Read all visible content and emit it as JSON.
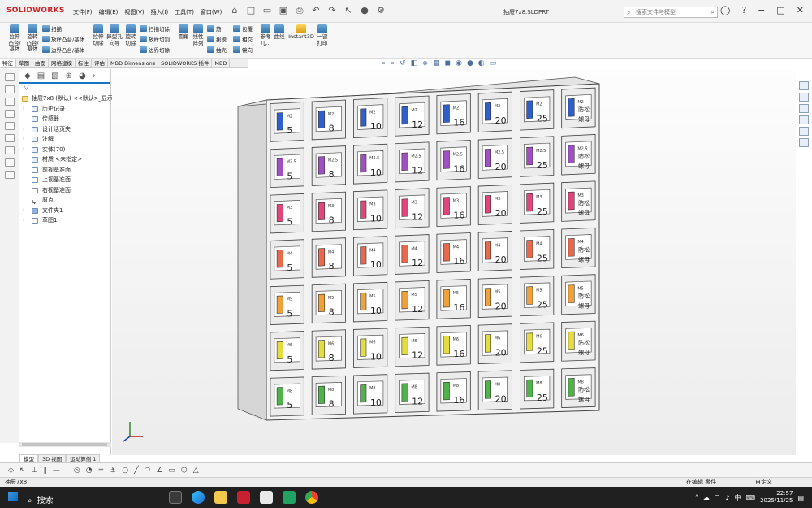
{
  "app": {
    "brand": "SOLIDWORKS",
    "menus": [
      "文件(F)",
      "编辑(E)",
      "视图(V)",
      "插入(I)",
      "工具(T)",
      "窗口(W)"
    ],
    "doc_title": "抽屉7x8.SLDPRT",
    "search_placeholder": "搜索文件与模型"
  },
  "ribbon": {
    "big": [
      {
        "id": "extrude-boss",
        "label": "拉伸\n凸台/\n基体"
      },
      {
        "id": "revolve-boss",
        "label": "旋转\n凸台/\n基体"
      },
      {
        "id": "extrude-cut",
        "label": "拉伸\n切除"
      },
      {
        "id": "hole-wizard",
        "label": "异型孔\n向导"
      },
      {
        "id": "revolve-cut",
        "label": "旋转\n切除"
      },
      {
        "id": "fillet",
        "label": "圆角"
      },
      {
        "id": "linear-pattern",
        "label": "线性\n阵列"
      },
      {
        "id": "rib",
        "label": "筋"
      },
      {
        "id": "reference",
        "label": "参考\n几..."
      },
      {
        "id": "curves",
        "label": "曲线"
      },
      {
        "id": "instant3d",
        "label": "Instant3D"
      },
      {
        "id": "one-key-print",
        "label": "一键\n打印"
      }
    ],
    "small": [
      {
        "id": "sweep",
        "label": "扫描"
      },
      {
        "id": "loft",
        "label": "放样凸台/基体"
      },
      {
        "id": "boundary",
        "label": "边界凸台/基体"
      },
      {
        "id": "sweep-cut",
        "label": "扫描切除"
      },
      {
        "id": "loft-cut",
        "label": "放样切割"
      },
      {
        "id": "boundary-cut",
        "label": "边界切除"
      },
      {
        "id": "draft",
        "label": "拔模"
      },
      {
        "id": "shell",
        "label": "抽壳"
      },
      {
        "id": "wrap",
        "label": "包覆"
      },
      {
        "id": "intersect",
        "label": "相交"
      },
      {
        "id": "mirror",
        "label": "镜向"
      }
    ]
  },
  "cm_tabs": [
    "特征",
    "草图",
    "曲面",
    "网格建模",
    "标注",
    "评估",
    "MBD Dimensions",
    "SOLIDWORKS 插件",
    "MBD"
  ],
  "tree": {
    "root": "抽屉7x8 (默认) <<默认>_显示",
    "items": [
      "历史记录",
      "传感器",
      "设计活页夹",
      "注解",
      "实体(70)",
      "材质 <未指定>",
      "前视基准面",
      "上视基准面",
      "右视基准面",
      "原点",
      "文件夹1",
      "草图1"
    ]
  },
  "model_tabs": [
    "模型",
    "3D 视图",
    "运动算例 1"
  ],
  "drawers": {
    "rows": [
      {
        "size": "M2",
        "color": "#2f5fc8"
      },
      {
        "size": "M2.5",
        "color": "#a24fc4"
      },
      {
        "size": "M3",
        "color": "#e0457c"
      },
      {
        "size": "M4",
        "color": "#e86a4c"
      },
      {
        "size": "M5",
        "color": "#f0a13a"
      },
      {
        "size": "M6",
        "color": "#e4dc40"
      },
      {
        "size": "M8",
        "color": "#4fb34a"
      }
    ],
    "lengths": [
      "5",
      "8",
      "10",
      "12",
      "16",
      "20",
      "25"
    ],
    "last_label": "防松\n螺母"
  },
  "status": {
    "left": "抽屉7x8",
    "mode": "在编辑 零件",
    "units": "自定义"
  },
  "taskbar": {
    "search": "搜索",
    "ime": "中",
    "time": "22:57",
    "date": "2025/11/25"
  },
  "icons": [
    "home-icon",
    "new-icon",
    "open-icon",
    "save-icon",
    "print-icon",
    "undo-icon",
    "redo-icon",
    "select-icon",
    "traffic-light-icon",
    "options-icon",
    "user-icon",
    "help-icon",
    "minimize-icon",
    "maximize-icon",
    "close-icon"
  ]
}
